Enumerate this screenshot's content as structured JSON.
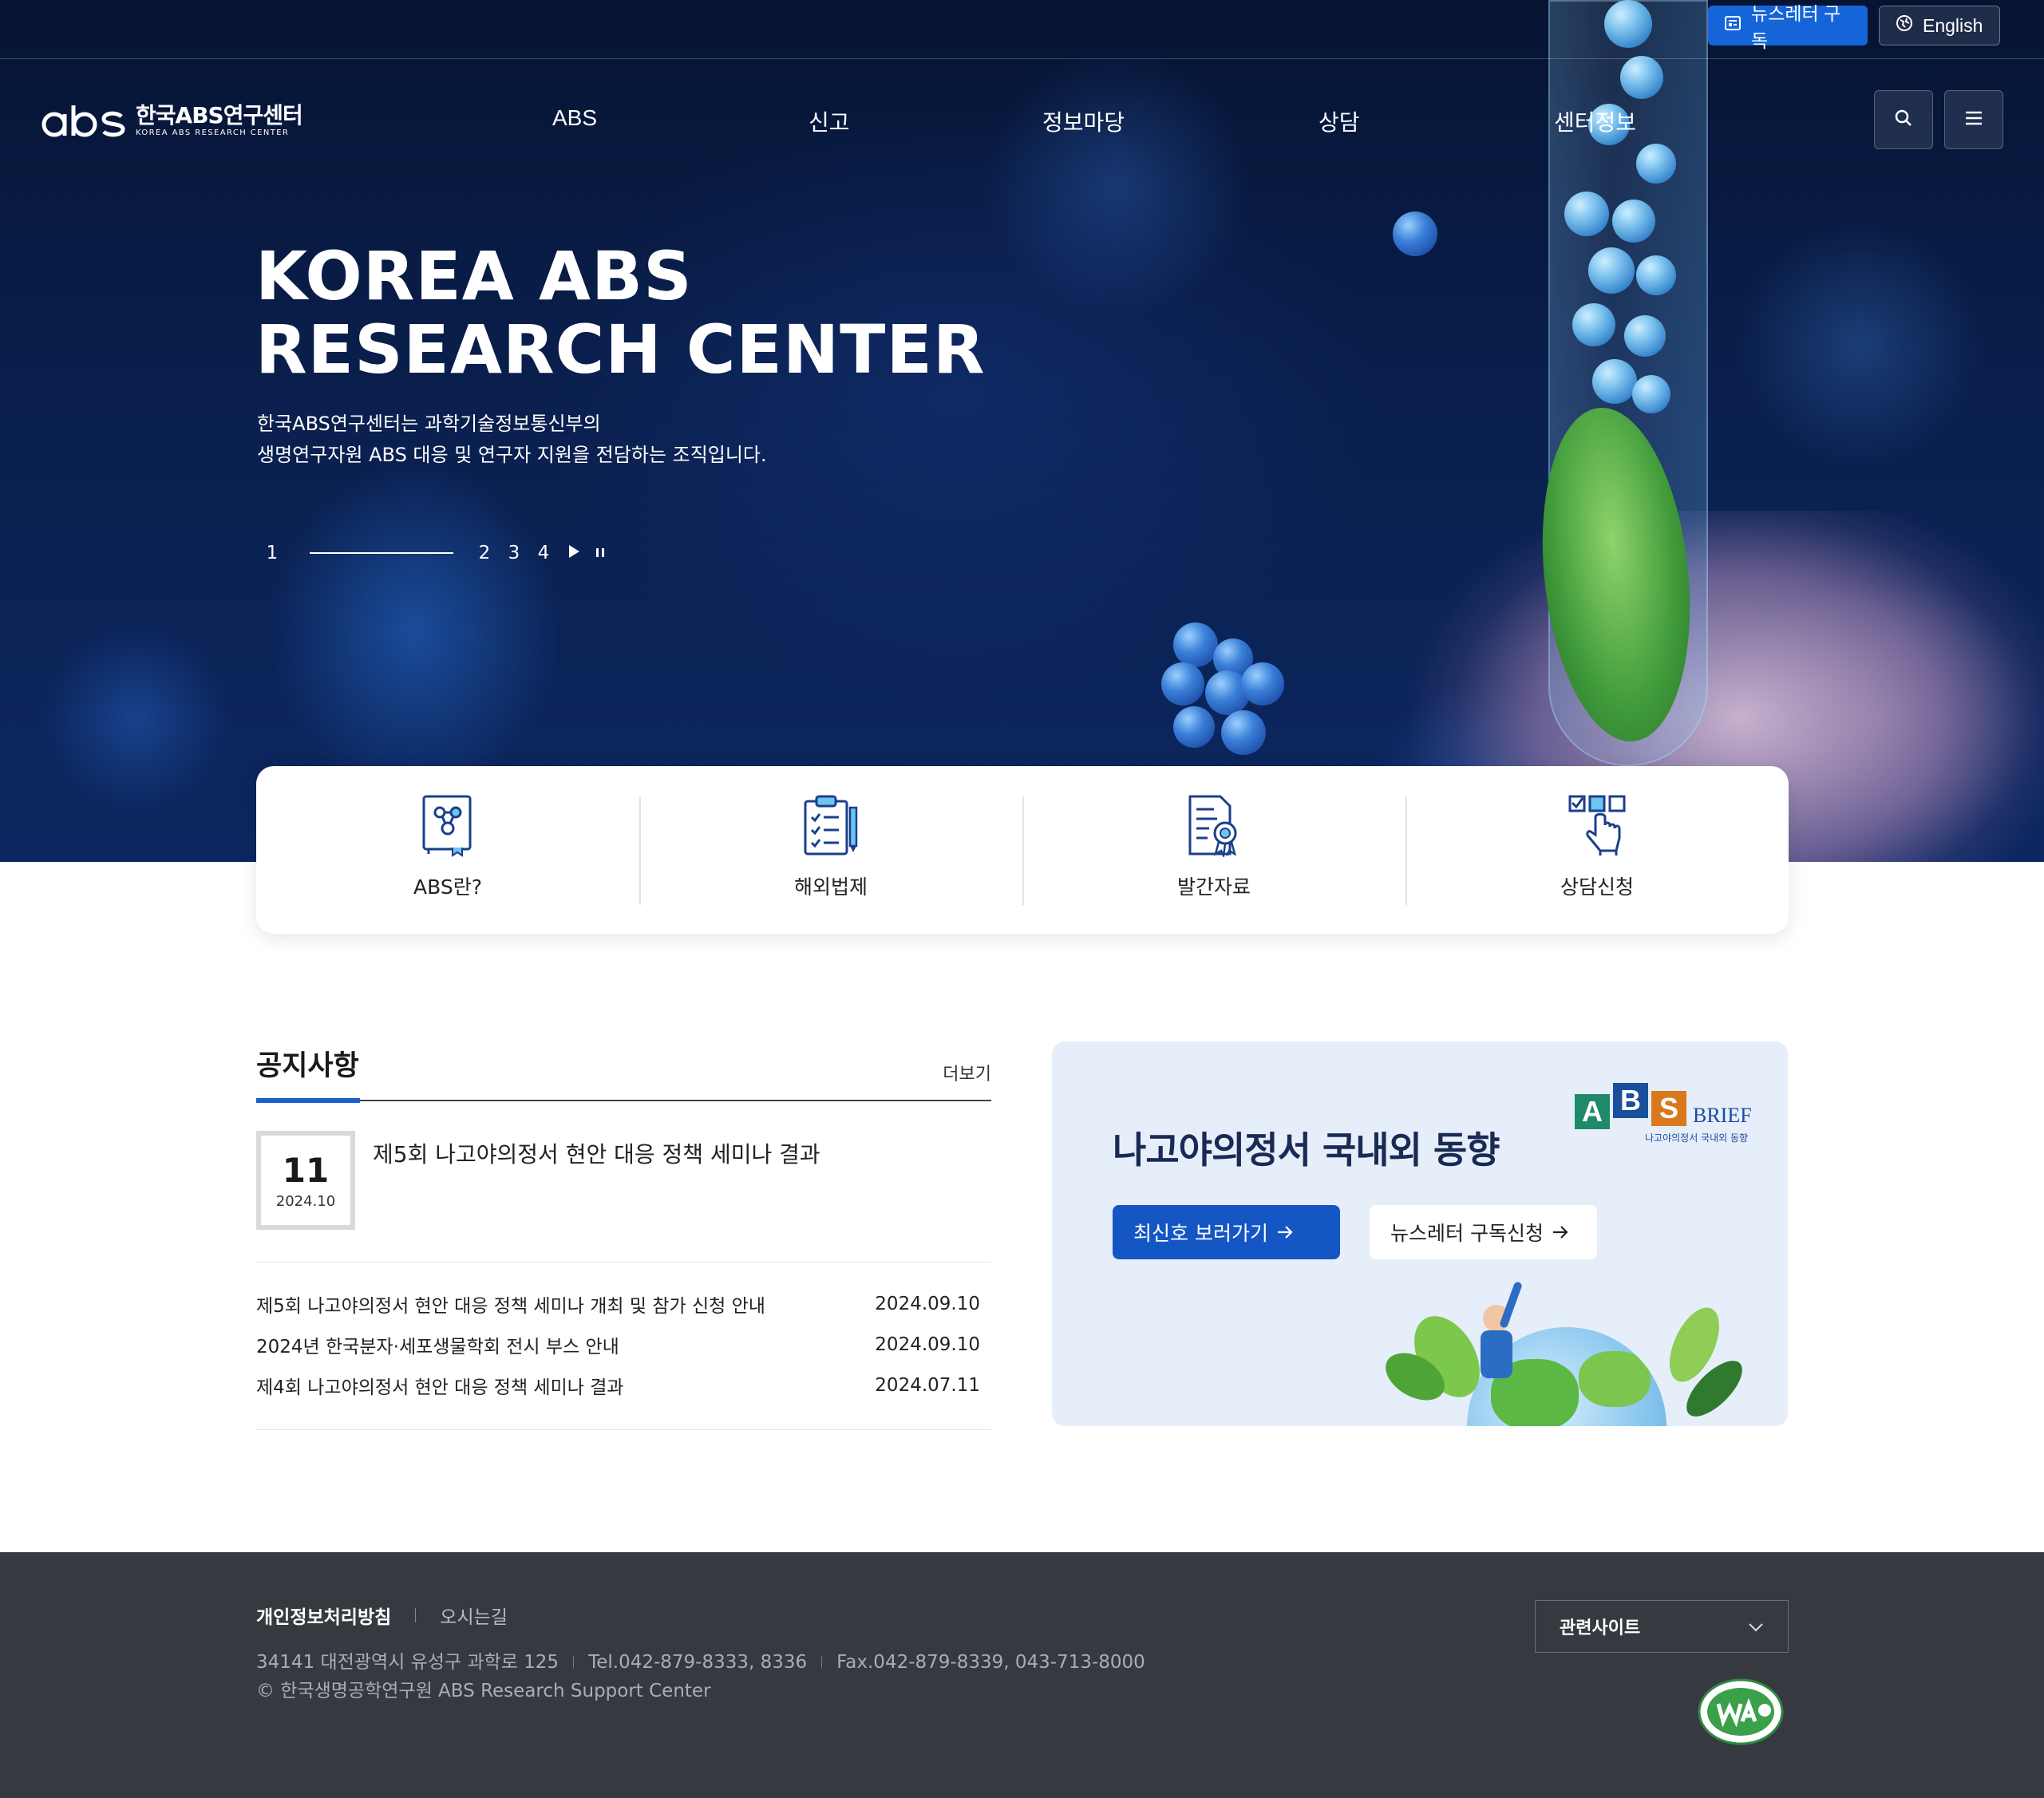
{
  "topbar": {
    "newsletter_label": "뉴스레터 구독",
    "language_label": "English"
  },
  "logo": {
    "name_kr": "한국ABS연구센터",
    "name_en": "KOREA ABS RESEARCH CENTER"
  },
  "nav": {
    "items": [
      {
        "label": "ABS"
      },
      {
        "label": "신고"
      },
      {
        "label": "정보마당"
      },
      {
        "label": "상담"
      },
      {
        "label": "센터정보"
      }
    ]
  },
  "icons": {
    "search": "search-icon",
    "menu": "hamburger-menu-icon",
    "newsletter": "newsletter-icon",
    "language": "globe-icon"
  },
  "hero": {
    "title_line1": "KOREA ABS",
    "title_line2": "RESEARCH CENTER",
    "desc_line1": "한국ABS연구센터는 과학기술정보통신부의",
    "desc_line2": "생명연구자원 ABS 대응 및 연구자 지원을 전담하는 조직입니다.",
    "slider": {
      "current": "1",
      "others": [
        "2",
        "3",
        "4"
      ]
    }
  },
  "quick_menu": [
    {
      "label": "ABS란?",
      "icon": "book-network-icon"
    },
    {
      "label": "해외법제",
      "icon": "checklist-clipboard-icon"
    },
    {
      "label": "발간자료",
      "icon": "document-certificate-icon"
    },
    {
      "label": "상담신청",
      "icon": "checkbox-pointer-icon"
    }
  ],
  "notice": {
    "title": "공지사항",
    "more_label": "더보기",
    "featured": {
      "day": "11",
      "year_month": "2024.10",
      "title": "제5회 나고야의정서 현안 대응 정책 세미나 결과"
    },
    "items": [
      {
        "title": "제5회 나고야의정서 현안 대응 정책 세미나 개최 및 참가 신청 안내",
        "date": "2024.09.10"
      },
      {
        "title": "2024년 한국분자·세포생물학회 전시 부스 안내",
        "date": "2024.09.10"
      },
      {
        "title": "제4회 나고야의정서 현안 대응 정책 세미나 결과",
        "date": "2024.07.11"
      }
    ]
  },
  "brief": {
    "title": "나고야의정서 국내외 동향",
    "primary_button": "최신호 보러가기",
    "secondary_button": "뉴스레터 구독신청",
    "logo_letters": [
      "A",
      "B",
      "S"
    ],
    "logo_word": "BRIEF",
    "logo_sub": "나고야의정서 국내외 동향"
  },
  "footer": {
    "privacy_label": "개인정보처리방침",
    "directions_label": "오시는길",
    "address": "34141 대전광역시 유성구 과학로 125",
    "tel": "Tel.042-879-8333, 8336",
    "fax": "Fax.042-879-8339, 043-713-8000",
    "copyright": "© 한국생명공학연구원 ABS Research Support Center",
    "related_sites_label": "관련사이트"
  },
  "colors": {
    "accent": "#1565d8",
    "brief_button": "#1456c4",
    "brief_bg": "#e6eef9",
    "footer_bg": "#363a40",
    "hero_bg": "#0a1f4d",
    "logo_a": "#1f8a6a",
    "logo_b": "#1a4f9c",
    "logo_s": "#d9781d"
  }
}
